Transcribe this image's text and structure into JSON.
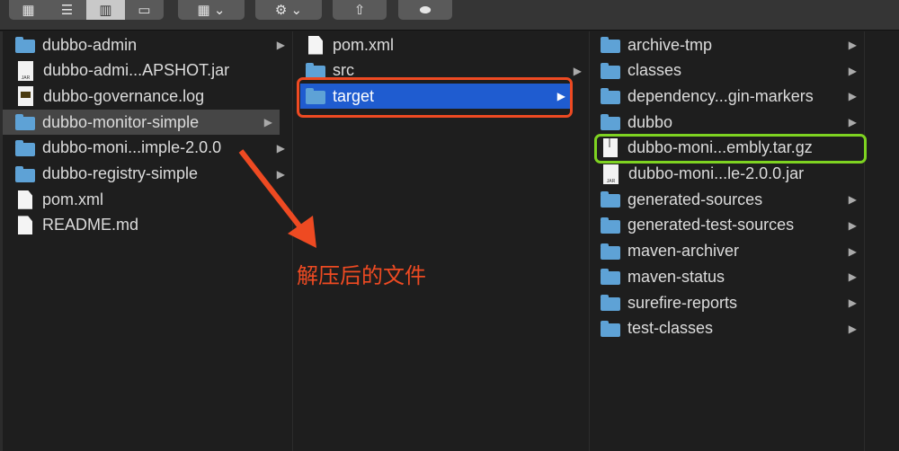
{
  "toolbar": {
    "view_icons": [
      "icon-view-icon",
      "list-view-icon",
      "column-view-icon",
      "gallery-view-icon"
    ],
    "group_icon": "grid-icon",
    "action_icon": "gear-icon",
    "share_icon": "share-icon",
    "tag_icon": "tag-icon"
  },
  "columns": [
    {
      "items": [
        {
          "name": "dubbo-admin",
          "type": "folder",
          "arrow": true
        },
        {
          "name": "dubbo-admi...APSHOT.jar",
          "type": "jar"
        },
        {
          "name": "dubbo-governance.log",
          "type": "log"
        },
        {
          "name": "dubbo-monitor-simple",
          "type": "folder",
          "arrow": true,
          "selected": "gray"
        },
        {
          "name": "dubbo-moni...imple-2.0.0",
          "type": "folder",
          "arrow": true
        },
        {
          "name": "dubbo-registry-simple",
          "type": "folder",
          "arrow": true
        },
        {
          "name": "pom.xml",
          "type": "doc"
        },
        {
          "name": "README.md",
          "type": "doc"
        }
      ]
    },
    {
      "items": [
        {
          "name": "pom.xml",
          "type": "doc"
        },
        {
          "name": "src",
          "type": "folder",
          "arrow": true
        },
        {
          "name": "target",
          "type": "folder",
          "arrow": true,
          "selected": "blue"
        }
      ]
    },
    {
      "items": [
        {
          "name": "archive-tmp",
          "type": "folder",
          "arrow": true
        },
        {
          "name": "classes",
          "type": "folder",
          "arrow": true
        },
        {
          "name": "dependency...gin-markers",
          "type": "folder",
          "arrow": true
        },
        {
          "name": "dubbo",
          "type": "folder",
          "arrow": true
        },
        {
          "name": "dubbo-moni...embly.tar.gz",
          "type": "tgz"
        },
        {
          "name": "dubbo-moni...le-2.0.0.jar",
          "type": "jar"
        },
        {
          "name": "generated-sources",
          "type": "folder",
          "arrow": true
        },
        {
          "name": "generated-test-sources",
          "type": "folder",
          "arrow": true
        },
        {
          "name": "maven-archiver",
          "type": "folder",
          "arrow": true
        },
        {
          "name": "maven-status",
          "type": "folder",
          "arrow": true
        },
        {
          "name": "surefire-reports",
          "type": "folder",
          "arrow": true
        },
        {
          "name": "test-classes",
          "type": "folder",
          "arrow": true
        }
      ]
    }
  ],
  "annotation": {
    "text": "解压后的文件",
    "color": "#ee4a22",
    "highlight_color": "#7ed321"
  }
}
